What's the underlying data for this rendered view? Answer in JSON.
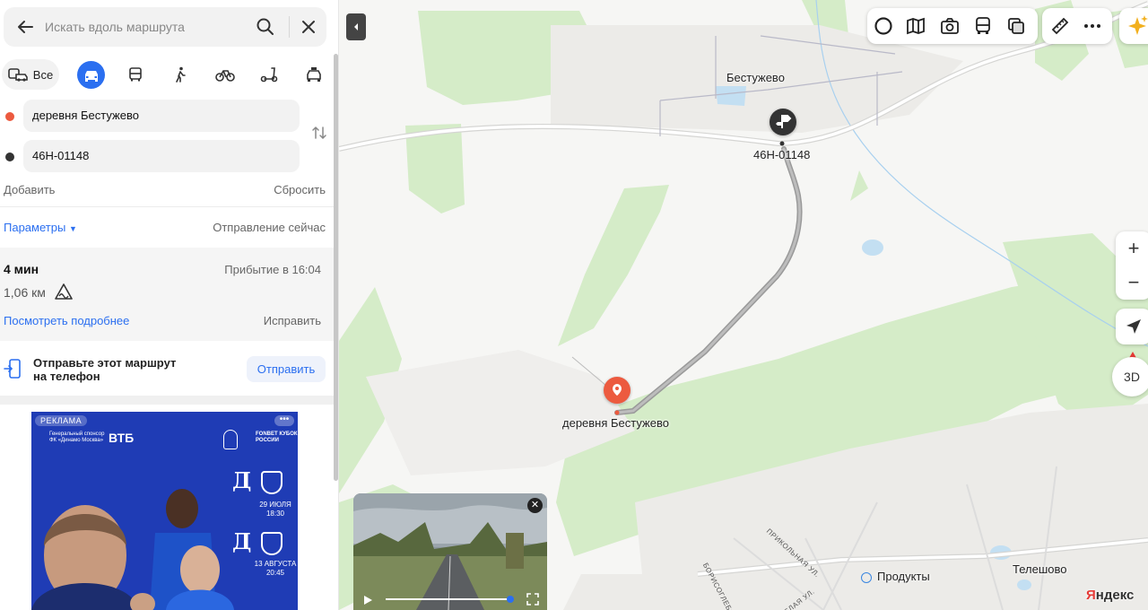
{
  "search": {
    "placeholder": "Искать вдоль маршрута"
  },
  "modes": {
    "all_label": "Все",
    "items": [
      "car-icon",
      "bus-icon",
      "walk-icon",
      "bicycle-icon",
      "scooter-icon",
      "taxi-icon"
    ],
    "active": "car-icon"
  },
  "route_points": {
    "from": "деревня Бестужево",
    "to": "46Н-01148",
    "from_color": "#ec5a3f",
    "to_color": "#333333"
  },
  "actions": {
    "add": "Добавить",
    "reset": "Сбросить",
    "params": "Параметры",
    "departure": "Отправление сейчас"
  },
  "route": {
    "duration": "4 мин",
    "arrival": "Прибытие в 16:04",
    "distance": "1,06 км",
    "details_link": "Посмотреть подробнее",
    "fix_link": "Исправить"
  },
  "send": {
    "text_line1": "Отправьте этот маршрут",
    "text_line2": "на телефон",
    "button": "Отправить"
  },
  "ad": {
    "tag": "РЕКЛАМА",
    "sponsor": "Генеральный спонсор ФК «Динамо Москва»",
    "vtb": "ВТБ",
    "fonbet": "FONBET КУБОК РОССИИ",
    "match1_date": "29 ИЮЛЯ",
    "match1_time": "18:30",
    "match2_date": "13 АВГУСТА",
    "match2_time": "20:45"
  },
  "map": {
    "label_village_top": "Бестужево",
    "label_road": "46Н-01148",
    "label_village_route": "деревня Бестужево",
    "label_products": "Продукты",
    "label_teleshovo": "Телешово",
    "street1": "ПРИКОЛЬНАЯ УЛ.",
    "street2": "БОРИСОГЛЕБСКАЯ",
    "street3": "БЕЛАЯ УЛ.",
    "button_3d": "3D",
    "logo_first": "Я",
    "logo_rest": "ндекс",
    "route_color": "#9a9a9a",
    "forest_color": "#d5ecc8"
  }
}
